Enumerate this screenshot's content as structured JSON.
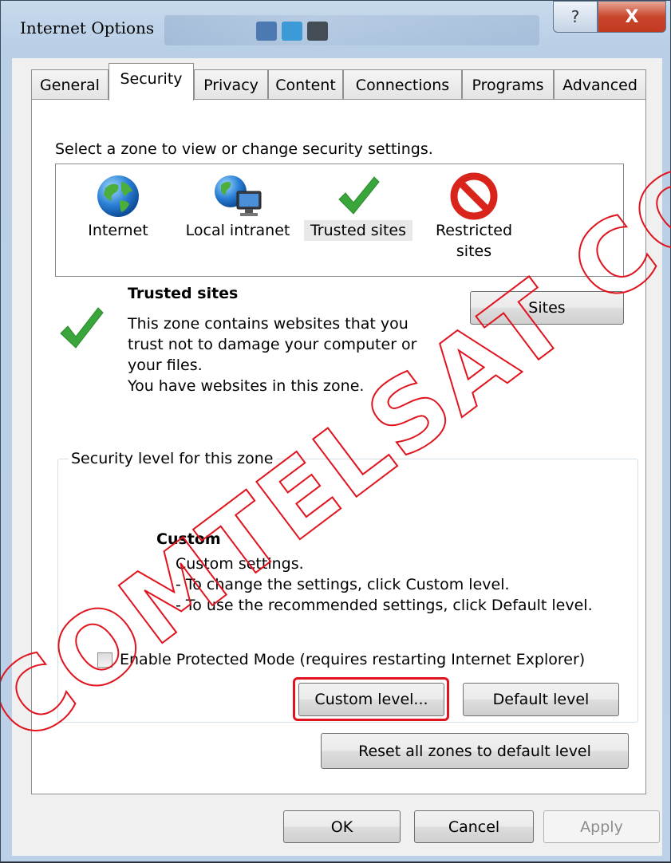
{
  "window": {
    "title": "Internet Options",
    "help_label": "?",
    "close_label": "X"
  },
  "tabs": [
    {
      "label": "General"
    },
    {
      "label": "Security",
      "active": true
    },
    {
      "label": "Privacy"
    },
    {
      "label": "Content"
    },
    {
      "label": "Connections"
    },
    {
      "label": "Programs"
    },
    {
      "label": "Advanced"
    }
  ],
  "security": {
    "zone_prompt": "Select a zone to view or change security settings.",
    "zones": [
      {
        "line1": "Internet",
        "line2": "",
        "icon": "globe-icon"
      },
      {
        "line1": "Local intranet",
        "line2": "",
        "icon": "intranet-icon"
      },
      {
        "line1": "Trusted sites",
        "line2": "",
        "icon": "checkmark-icon",
        "selected": true
      },
      {
        "line1": "Restricted",
        "line2": "sites",
        "icon": "restricted-icon"
      }
    ],
    "selected_zone": {
      "title": "Trusted sites",
      "description": [
        "This zone contains websites that you",
        "trust not to damage your computer or",
        "your files.",
        "You have websites in this zone."
      ],
      "sites_button": "Sites"
    },
    "level_group": {
      "legend": "Security level for this zone",
      "level_name": "Custom",
      "level_lines": [
        "Custom settings.",
        "- To change the settings, click Custom level.",
        "- To use the recommended settings, click Default level."
      ],
      "protected_mode_label": "Enable Protected Mode (requires restarting Internet Explorer)",
      "protected_mode_checked": false,
      "custom_level_button": "Custom level...",
      "default_level_button": "Default level"
    },
    "reset_button": "Reset all zones to default level"
  },
  "footer": {
    "ok_label": "OK",
    "cancel_label": "Cancel",
    "apply_label": "Apply"
  },
  "watermark": {
    "text": "COMTELSAT CO.,LTD"
  },
  "colors": {
    "highlight": "#e0141e",
    "check_green": "#3aa53a",
    "restricted_red": "#d9241c"
  }
}
